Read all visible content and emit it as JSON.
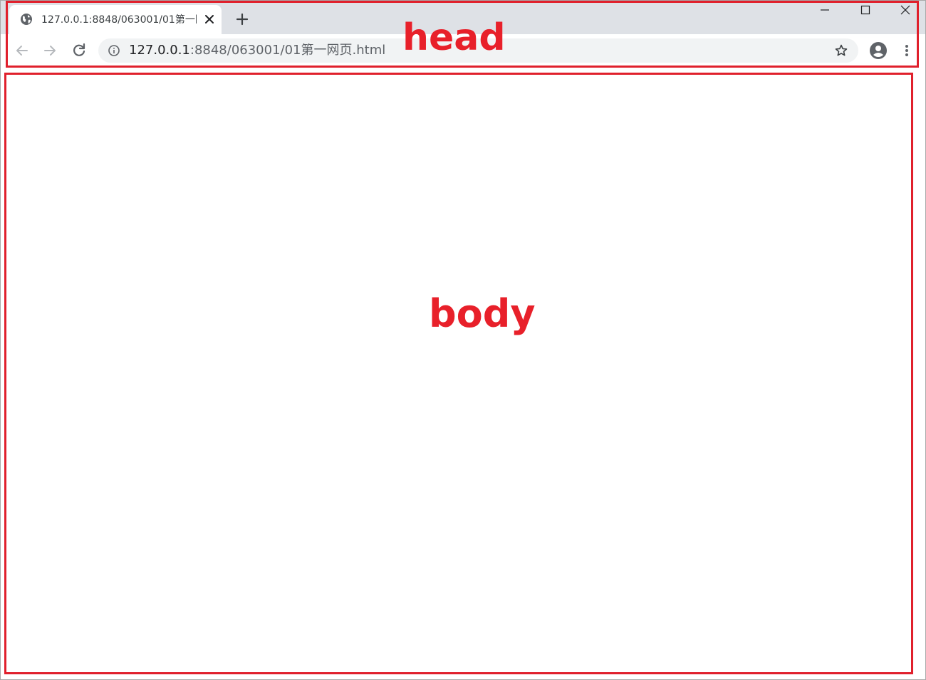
{
  "browser": {
    "tab": {
      "title": "127.0.0.1:8848/063001/01第一网页.html",
      "favicon": "globe-icon",
      "close_icon": "close-icon"
    },
    "new_tab_icon": "plus-icon",
    "window_controls": [
      "minimize-icon",
      "maximize-icon",
      "close-icon"
    ],
    "address_bar": {
      "url_host": "127.0.0.1",
      "url_path": ":8848/063001/01第一网页.html",
      "info_icon": "info-icon",
      "bookmark_icon": "star-icon"
    },
    "nav_icons": [
      "back-arrow-icon",
      "forward-arrow-icon",
      "reload-icon"
    ],
    "profile_icon": "account-icon",
    "menu_icon": "more-vert-icon"
  },
  "annotations": {
    "head_label": "head",
    "body_label": "body",
    "color": "#e8202a"
  }
}
